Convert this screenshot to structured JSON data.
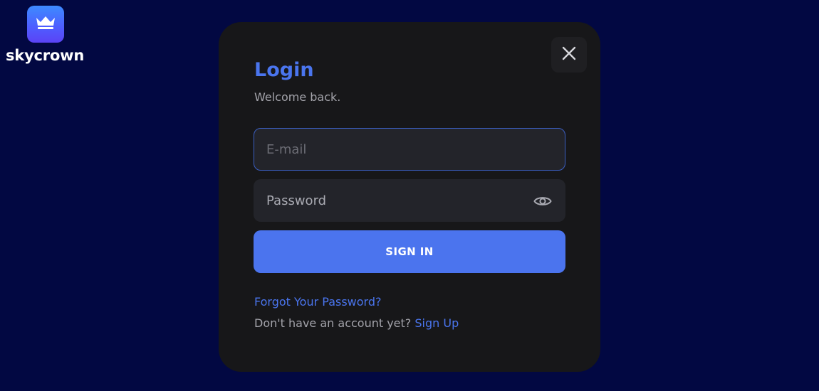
{
  "brand": {
    "name": "skycrown",
    "logo_icon": "crown-icon",
    "logo_gradient": [
      "#3d8bff",
      "#5b43f5"
    ]
  },
  "modal": {
    "title": "Login",
    "subtitle": "Welcome back.",
    "close_icon": "close-icon"
  },
  "form": {
    "email": {
      "placeholder": "E-mail",
      "value": ""
    },
    "password": {
      "placeholder": "Password",
      "value": "",
      "toggle_icon": "eye-icon"
    },
    "submit_label": "SIGN IN"
  },
  "links": {
    "forgot_password": "Forgot Your Password?",
    "signup_prompt": "Don't have an account yet?",
    "signup": "Sign Up"
  },
  "colors": {
    "page_background": "#020842",
    "modal_background": "#171719",
    "accent": "#4b74ee",
    "input_background": "#23242a",
    "focused_border": "#3b5fc2"
  }
}
